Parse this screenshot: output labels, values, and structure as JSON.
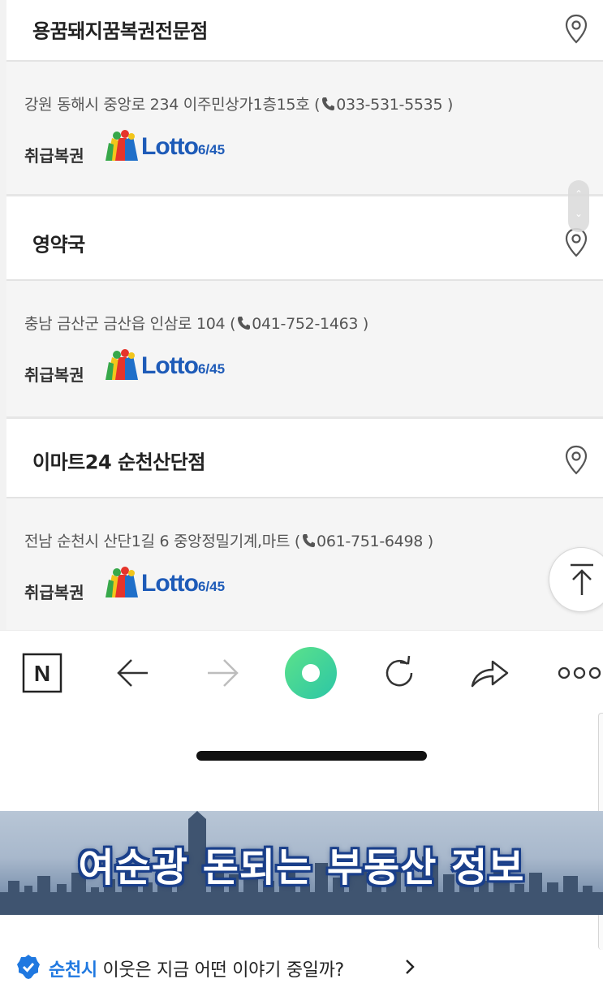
{
  "stores": [
    {
      "name": "용꿈돼지꿈복권전문점",
      "address": "강원 동해시 중앙로 234 이주민상가1층15호",
      "phone": "033-531-5535",
      "handling_label": "취급복권",
      "lotto_logo": "Lotto",
      "lotto_logo_sub": "6/45"
    },
    {
      "name": "영약국",
      "address": "충남 금산군 금산읍 인삼로 104",
      "phone": "041-752-1463",
      "handling_label": "취급복권",
      "lotto_logo": "Lotto",
      "lotto_logo_sub": "6/45"
    },
    {
      "name": "이마트24 순천산단점",
      "address": "전남 순천시 산단1길 6 중앙정밀기계,마트",
      "phone": "061-751-6498",
      "handling_label": "취급복권",
      "lotto_logo": "Lotto",
      "lotto_logo_sub": "6/45"
    }
  ],
  "icons": {
    "location": "location-pin-icon",
    "phone": "phone-icon",
    "scroll_top": "arrow-up-to-top-icon",
    "naver": "naver-n-icon",
    "back": "arrow-left-icon",
    "forward": "arrow-right-icon",
    "home": "green-circle-icon",
    "reload": "reload-icon",
    "share": "share-arrow-icon",
    "more": "more-dots-icon",
    "verified": "verified-check-icon",
    "chevron": "chevron-right-icon"
  },
  "toolbar": {
    "naver_label": "N"
  },
  "banner": {
    "text": "여순광 돈되는 부동산 정보"
  },
  "neighbor": {
    "city": "순천시",
    "text": "이웃은 지금 어떤 이야기 중일까?"
  },
  "colors": {
    "accent_green": "#3ddc84",
    "link_blue": "#1f78e0",
    "lotto_blue": "#1e5bb8",
    "banner_outline": "#1a3f8a"
  }
}
